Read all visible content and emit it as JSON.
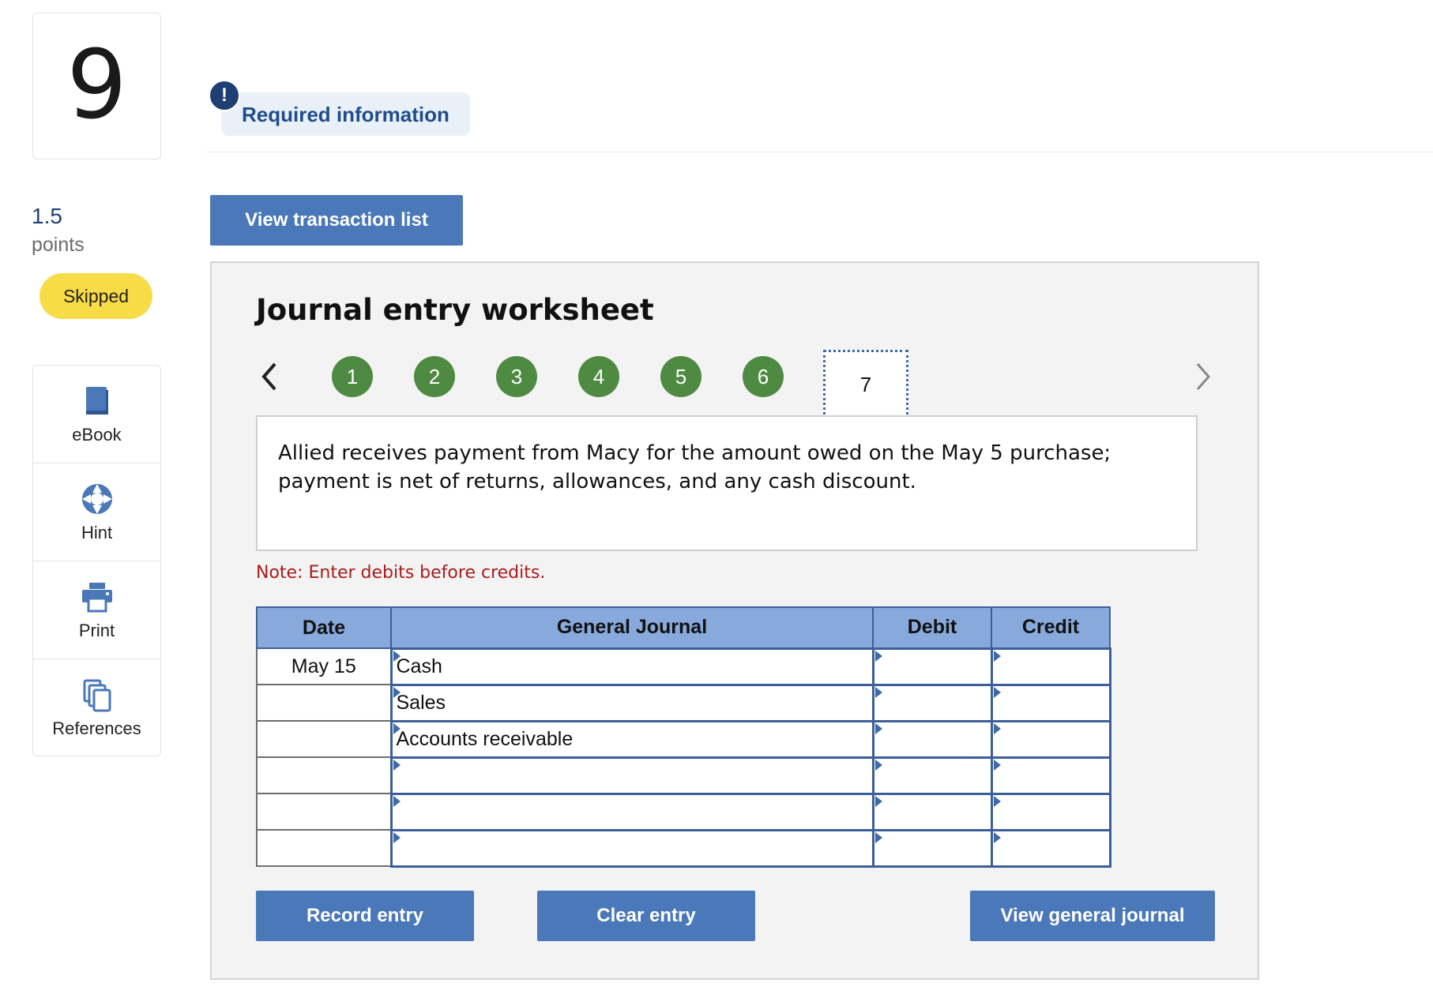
{
  "question": {
    "number": "9",
    "points_value": "1.5",
    "points_label": "points",
    "status": "Skipped"
  },
  "tools": [
    {
      "label": "eBook",
      "icon": "book-icon"
    },
    {
      "label": "Hint",
      "icon": "lifebuoy-icon"
    },
    {
      "label": "Print",
      "icon": "printer-icon"
    },
    {
      "label": "References",
      "icon": "copy-icon"
    }
  ],
  "header": {
    "badge": "!",
    "required_info": "Required information",
    "view_transaction_list": "View transaction list"
  },
  "worksheet": {
    "title": "Journal entry worksheet",
    "steps": [
      "1",
      "2",
      "3",
      "4",
      "5",
      "6",
      "7"
    ],
    "active_step": "7",
    "description": "Allied receives payment from Macy for the amount owed on the May 5 purchase; payment is net of returns, allowances, and any cash discount.",
    "note": "Note: Enter debits before credits.",
    "table": {
      "headers": [
        "Date",
        "General Journal",
        "Debit",
        "Credit"
      ],
      "rows": [
        {
          "date": "May 15",
          "account": "Cash",
          "debit": "",
          "credit": ""
        },
        {
          "date": "",
          "account": "Sales",
          "debit": "",
          "credit": ""
        },
        {
          "date": "",
          "account": "Accounts receivable",
          "debit": "",
          "credit": ""
        },
        {
          "date": "",
          "account": "",
          "debit": "",
          "credit": ""
        },
        {
          "date": "",
          "account": "",
          "debit": "",
          "credit": ""
        },
        {
          "date": "",
          "account": "",
          "debit": "",
          "credit": ""
        }
      ]
    },
    "buttons": {
      "record": "Record entry",
      "clear": "Clear entry",
      "view_general_journal": "View general journal"
    }
  },
  "colors": {
    "primary_button": "#4a78b8",
    "step_complete": "#4f8a42",
    "skipped_badge": "#f8dc47",
    "table_header": "#87a9db",
    "note_text": "#a81c1c"
  }
}
